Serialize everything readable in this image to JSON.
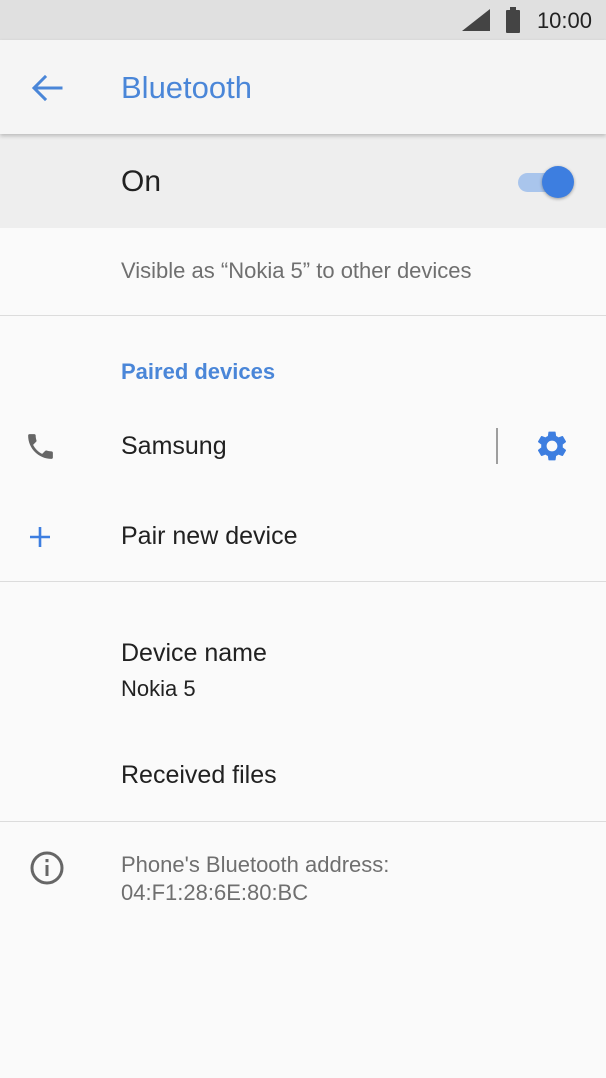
{
  "status_bar": {
    "time": "10:00",
    "signal_icon": "signal-icon",
    "battery_icon": "battery-icon"
  },
  "app_bar": {
    "title": "Bluetooth",
    "back_icon": "arrow-back-icon"
  },
  "bluetooth_toggle": {
    "label": "On",
    "state": "on"
  },
  "visibility_text": "Visible as “Nokia 5” to other devices",
  "paired_devices": {
    "heading": "Paired devices",
    "items": [
      {
        "name": "Samsung",
        "icon": "phone-icon",
        "settings_icon": "gear-icon"
      }
    ]
  },
  "pair_new": {
    "label": "Pair new device",
    "icon": "plus-icon"
  },
  "device_name": {
    "label": "Device name",
    "value": "Nokia 5"
  },
  "received_files": {
    "label": "Received files"
  },
  "bluetooth_address": {
    "text": "Phone's Bluetooth address: 04:F1:28:6E:80:BC",
    "icon": "info-icon"
  },
  "colors": {
    "accent": "#4a86d8",
    "toggle_thumb": "#3d7ee0",
    "toggle_track": "#a9c5ec"
  }
}
